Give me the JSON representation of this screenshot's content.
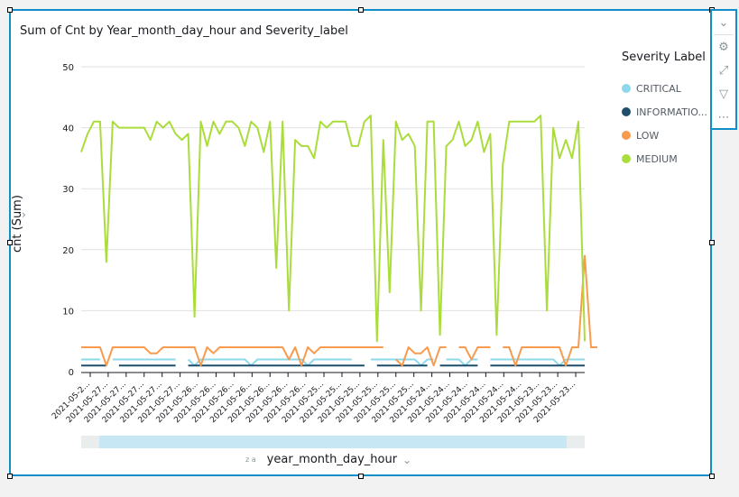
{
  "visual": {
    "title": "Sum of Cnt by Year_month_day_hour and Severity_label",
    "y_axis_title": "cnt (Sum)",
    "x_axis_title": "year_month_day_hour",
    "legend_title": "Severity Label",
    "toolbar": [
      {
        "icon": "collapse-icon",
        "glyph": "⌄"
      },
      {
        "icon": "gear-icon",
        "glyph": "⚙"
      },
      {
        "icon": "expand-icon",
        "glyph": "⤢"
      },
      {
        "icon": "filter-icon",
        "glyph": "▽"
      },
      {
        "icon": "more-icon",
        "glyph": "⋯"
      }
    ],
    "sort_icon_label": "z a",
    "chevron": "⌄",
    "ychevron": "›"
  },
  "chart_data": {
    "type": "line",
    "title": "Sum of Cnt by Year_month_day_hour and Severity_label",
    "xlabel": "year_month_day_hour",
    "ylabel": "cnt (Sum)",
    "ylim": [
      0,
      50
    ],
    "yticks": [
      0,
      10,
      20,
      30,
      40,
      50
    ],
    "grid": true,
    "legend_position": "right",
    "x_tick_labels": [
      "2021-05-2...",
      "2021-05-27...",
      "2021-05-27...",
      "2021-05-27...",
      "2021-05-27...",
      "2021-05-27...",
      "2021-05-26...",
      "2021-05-26...",
      "2021-05-26...",
      "2021-05-26...",
      "2021-05-26...",
      "2021-05-26...",
      "2021-05-26...",
      "2021-05-25...",
      "2021-05-25...",
      "2021-05-25...",
      "2021-05-25...",
      "2021-05-25...",
      "2021-05-25...",
      "2021-05-24...",
      "2021-05-24...",
      "2021-05-24...",
      "2021-05-24...",
      "2021-05-24...",
      "2021-05-24...",
      "2021-05-23...",
      "2021-05-23...",
      "2021-05-23..."
    ],
    "series": [
      {
        "name": "CRITICAL",
        "color": "#8ed8ec",
        "values": [
          2,
          2,
          2,
          2,
          null,
          2,
          2,
          2,
          2,
          2,
          2,
          2,
          2,
          2,
          2,
          2,
          null,
          2,
          1,
          2,
          2,
          2,
          2,
          2,
          2,
          2,
          2,
          1,
          2,
          2,
          2,
          2,
          2,
          2,
          2,
          2,
          1,
          2,
          2,
          2,
          2,
          2,
          2,
          2,
          null,
          null,
          2,
          2,
          2,
          2,
          2,
          2,
          2,
          2,
          1,
          2,
          2,
          null,
          2,
          2,
          2,
          1,
          2,
          2,
          null,
          2,
          2,
          2,
          2,
          2,
          2,
          2,
          2,
          2,
          2,
          2,
          1,
          2,
          2,
          2,
          2
        ]
      },
      {
        "name": "INFORMATIONAL",
        "color": "#1f4e6b",
        "values": [
          1,
          1,
          1,
          1,
          1,
          null,
          1,
          1,
          1,
          1,
          1,
          1,
          1,
          1,
          1,
          1,
          null,
          1,
          1,
          1,
          1,
          1,
          1,
          1,
          1,
          1,
          1,
          1,
          1,
          1,
          1,
          1,
          1,
          1,
          1,
          1,
          1,
          1,
          1,
          1,
          1,
          1,
          1,
          1,
          1,
          1,
          null,
          1,
          1,
          1,
          1,
          1,
          1,
          1,
          1,
          1,
          null,
          1,
          1,
          1,
          1,
          1,
          1,
          1,
          null,
          1,
          1,
          1,
          1,
          1,
          1,
          1,
          1,
          1,
          1,
          1,
          1,
          1,
          1,
          1,
          1
        ]
      },
      {
        "name": "LOW",
        "color": "#f89b4f",
        "values": [
          4,
          4,
          4,
          4,
          1,
          4,
          4,
          4,
          4,
          4,
          4,
          3,
          3,
          4,
          4,
          4,
          4,
          4,
          4,
          1,
          4,
          3,
          4,
          4,
          4,
          4,
          4,
          4,
          4,
          4,
          4,
          4,
          4,
          2,
          4,
          1,
          4,
          3,
          4,
          4,
          4,
          4,
          4,
          4,
          4,
          4,
          4,
          4,
          4,
          null,
          2,
          1,
          4,
          3,
          3,
          4,
          1,
          4,
          4,
          null,
          4,
          4,
          2,
          4,
          4,
          4,
          null,
          4,
          4,
          1,
          4,
          4,
          4,
          4,
          4,
          4,
          4,
          1,
          4,
          4,
          19,
          4,
          4
        ]
      },
      {
        "name": "MEDIUM",
        "color": "#aadd3b",
        "values": [
          36,
          39,
          41,
          41,
          18,
          41,
          40,
          40,
          40,
          40,
          40,
          38,
          41,
          40,
          41,
          39,
          38,
          39,
          9,
          41,
          37,
          41,
          39,
          41,
          41,
          40,
          37,
          41,
          40,
          36,
          41,
          17,
          41,
          10,
          38,
          37,
          37,
          35,
          41,
          40,
          41,
          41,
          41,
          37,
          37,
          41,
          42,
          5,
          38,
          13,
          41,
          38,
          39,
          37,
          10,
          41,
          41,
          6,
          37,
          38,
          41,
          37,
          38,
          41,
          36,
          39,
          6,
          34,
          41,
          41,
          41,
          41,
          41,
          42,
          10,
          40,
          35,
          38,
          35,
          41,
          5
        ]
      }
    ]
  }
}
